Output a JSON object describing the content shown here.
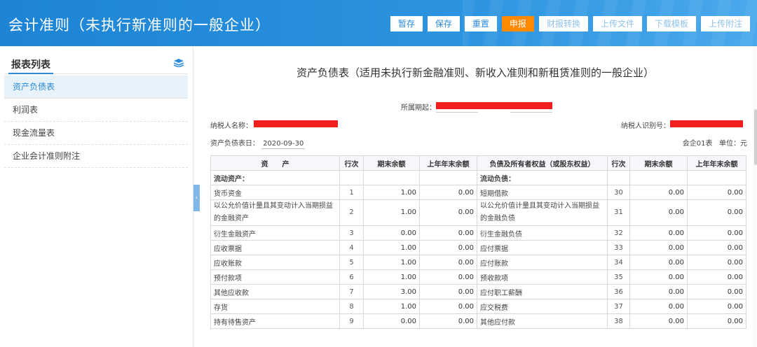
{
  "app": {
    "title": "会计准则（未执行新准则的一般企业）"
  },
  "toolbar": {
    "buttons": [
      {
        "label": "暂存",
        "style": "normal"
      },
      {
        "label": "保存",
        "style": "normal"
      },
      {
        "label": "重置",
        "style": "normal"
      },
      {
        "label": "申报",
        "style": "primary"
      },
      {
        "label": "财报转换",
        "style": "disabled"
      },
      {
        "label": "上传文件",
        "style": "disabled"
      },
      {
        "label": "下载模板",
        "style": "disabled"
      },
      {
        "label": "上传附注",
        "style": "disabled"
      }
    ]
  },
  "sidebar": {
    "title": "报表列表",
    "items": [
      {
        "label": "资产负债表",
        "active": true
      },
      {
        "label": "利润表"
      },
      {
        "label": "现金流量表"
      },
      {
        "label": "企业会计准则附注"
      }
    ]
  },
  "report": {
    "title": "资产负债表（适用未执行新金融准则、新收入准则和新租赁准则的一般企业）",
    "period_label": "所属期起：",
    "taxpayer_label": "纳税人名称：",
    "taxid_label": "纳税人识别号：",
    "date_label": "资产负债表日：",
    "date_value": "2020-09-30",
    "form_no": "会企01表",
    "unit": "单位：元"
  },
  "table": {
    "headers": [
      "资　　产",
      "行次",
      "期末余额",
      "上年年末余额",
      "负债及所有者权益（或股东权益）",
      "行次",
      "期末余额",
      "上年年末余额"
    ],
    "section_left": "流动资产：",
    "section_right": "流动负债：",
    "rows": [
      {
        "a": "货币资金",
        "al": "1",
        "ae": "1.00",
        "ab": "0.00",
        "l": "短期借款",
        "ll": "30",
        "le": "0.00",
        "lb": "0.00"
      },
      {
        "a": "以公允价值计量且其变动计入当期损益的金融资产",
        "al": "2",
        "ae": "1.00",
        "ab": "0.00",
        "l": "以公允价值计量且其变动计入当期损益的金融负债",
        "ll": "31",
        "le": "0.00",
        "lb": "0.00",
        "tall": true
      },
      {
        "a": "衍生金融资产",
        "al": "3",
        "ae": "0.00",
        "ab": "0.00",
        "l": "衍生金融负债",
        "ll": "32",
        "le": "0.00",
        "lb": "0.00"
      },
      {
        "a": "应收票据",
        "al": "4",
        "ae": "1.00",
        "ab": "0.00",
        "l": "应付票据",
        "ll": "33",
        "le": "0.00",
        "lb": "0.00"
      },
      {
        "a": "应收账款",
        "al": "5",
        "ae": "1.00",
        "ab": "0.00",
        "l": "应付账款",
        "ll": "34",
        "le": "0.00",
        "lb": "0.00"
      },
      {
        "a": "预付款项",
        "al": "6",
        "ae": "1.00",
        "ab": "0.00",
        "l": "预收款项",
        "ll": "35",
        "le": "0.00",
        "lb": "0.00"
      },
      {
        "a": "其他应收款",
        "al": "7",
        "ae": "3.00",
        "ab": "0.00",
        "l": "应付职工薪酬",
        "ll": "36",
        "le": "0.00",
        "lb": "0.00"
      },
      {
        "a": "存货",
        "al": "8",
        "ae": "1.00",
        "ab": "0.00",
        "l": "应交税费",
        "ll": "37",
        "le": "0.00",
        "lb": "0.00"
      },
      {
        "a": "持有待售资产",
        "al": "9",
        "ae": "0.00",
        "ab": "0.00",
        "l": "其他应付款",
        "ll": "38",
        "le": "0.00",
        "lb": "0.00"
      }
    ]
  },
  "colors": {
    "header_blue": "#2b8ad8",
    "primary_orange": "#ff8a00",
    "redaction": "#f21f1f"
  },
  "icons": {
    "sidebar_header": "layers-icon",
    "collapse": "chevron-left-icon"
  }
}
